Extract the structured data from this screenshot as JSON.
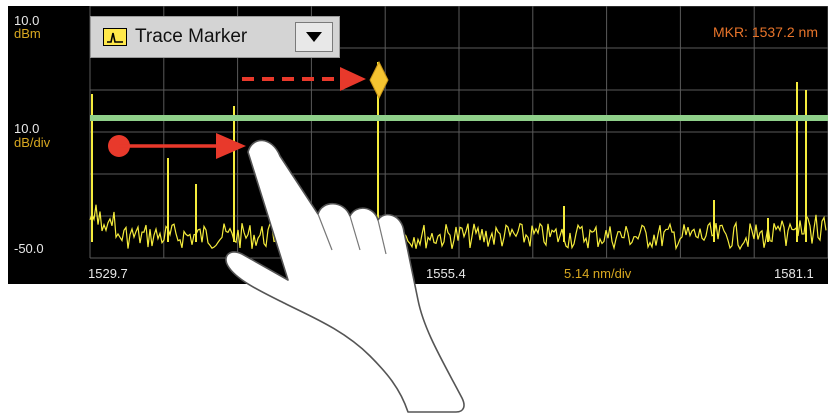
{
  "instrument": {
    "ref_level": "10.0",
    "ref_unit": "dBm",
    "scale": "10.0",
    "scale_unit": "dB/div",
    "bottom_level": "-50.0",
    "start_wavelength": "1529.7",
    "center_wavelength": "1555.4",
    "span_per_div": "5.14 nm/div",
    "stop_wavelength": "1581.1",
    "marker_readout": "MKR: 1537.2 nm"
  },
  "dropdown": {
    "selected": "Trace Marker",
    "icon": "trace-marker-icon",
    "arrow_icon": "triangle-down-icon"
  },
  "colors": {
    "trace": "#f5ec3c",
    "marker_line": "#8fd08a",
    "marker_diamond": "#f5c431",
    "arrow": "#e8392b",
    "background": "#000000"
  },
  "gestures": {
    "swipe_arrow": "red-solid-arrow",
    "marker_move_arrow": "red-dashed-arrow",
    "hand": "pointing-hand-icon"
  }
}
